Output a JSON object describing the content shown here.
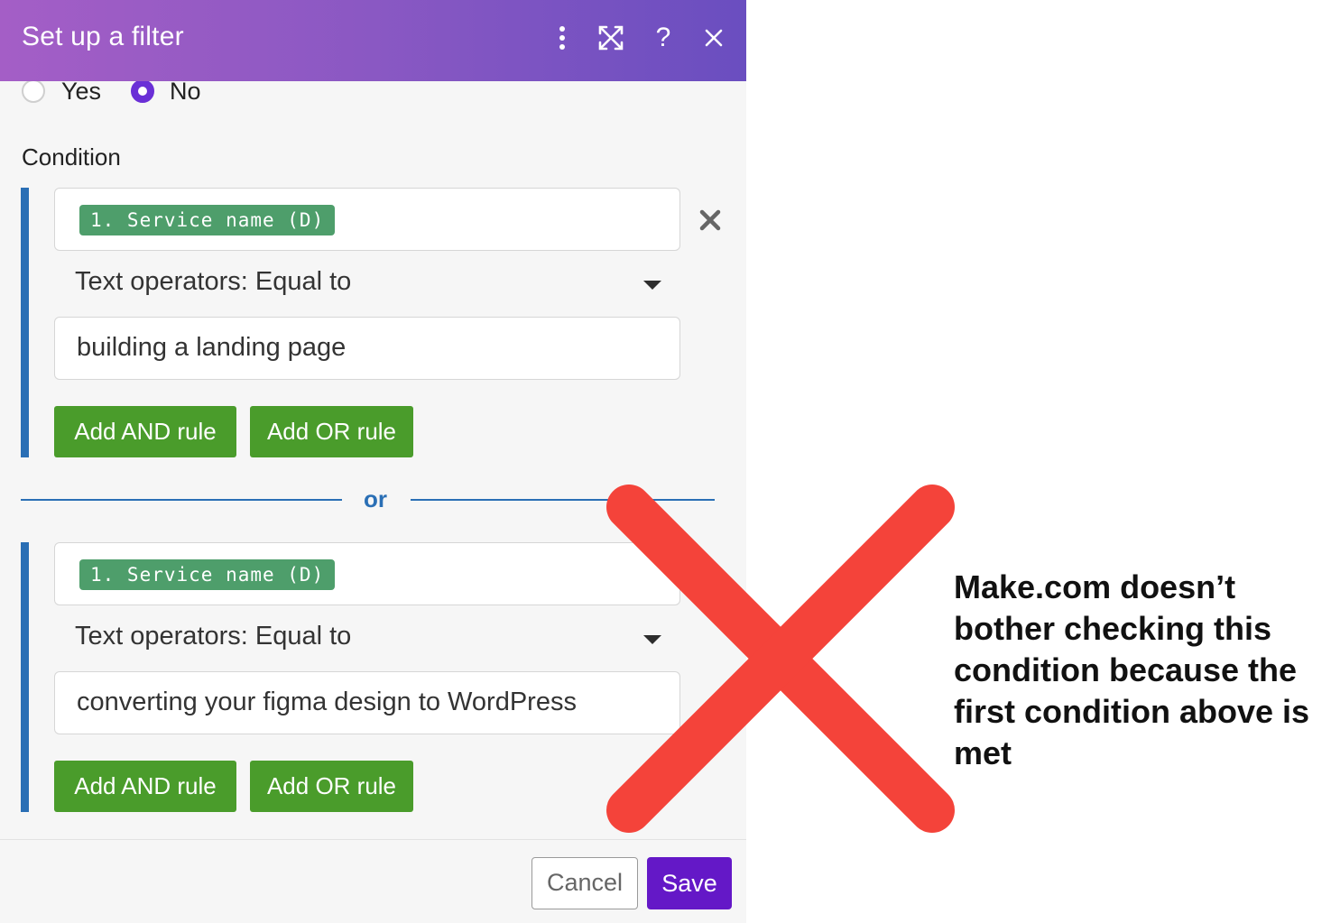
{
  "dialog": {
    "title": "Set up a filter",
    "help_label": "?"
  },
  "fallback": {
    "yes_label": "Yes",
    "no_label": "No",
    "selected": "No"
  },
  "condition_label": "Condition",
  "conditions": [
    {
      "field_pill": "1. Service name (D)",
      "operator": "Text operators: Equal to",
      "value": "building a landing page",
      "add_and_label": "Add AND rule",
      "add_or_label": "Add OR rule"
    },
    {
      "field_pill": "1. Service name (D)",
      "operator": "Text operators: Equal to",
      "value": "converting your figma design to WordPress",
      "add_and_label": "Add AND rule",
      "add_or_label": "Add OR rule"
    }
  ],
  "or_separator": "or",
  "footer": {
    "cancel_label": "Cancel",
    "save_label": "Save"
  },
  "annotation": {
    "note": "Make.com doesn’t bother checking this condition because the first condition above is met",
    "x_color": "#f4433a"
  },
  "colors": {
    "accent_purple": "#6418c7",
    "green_button": "#4a9c2b",
    "pill_green": "#4e9e6b",
    "condition_blue": "#2a6fb5"
  }
}
